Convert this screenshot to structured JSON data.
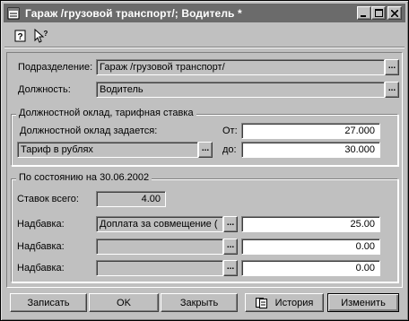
{
  "window": {
    "title": "Гараж /грузовой транспорт/; Водитель *"
  },
  "toolbar": {
    "help_icon": "help-icon",
    "whats_this_icon": "whats-this-icon"
  },
  "labels": {
    "department": "Подразделение:",
    "position": "Должность:",
    "salary_group": "Должностной оклад, тарифная ставка",
    "salary_set_by": "Должностной оклад задается:",
    "from": "От:",
    "to": "до:",
    "as_of_group": "По состоянию на 30.06.2002",
    "total_rates": "Ставок всего:",
    "bonus1": "Надбавка:",
    "bonus2": "Надбавка:",
    "bonus3": "Надбавка:"
  },
  "fields": {
    "department": "Гараж /грузовой транспорт/",
    "position": "Водитель",
    "salary_type": "Тариф в рублях",
    "from_value": "27.000",
    "to_value": "30.000",
    "total_rates": "4.00",
    "bonus1_type": "Доплата за совмещение (",
    "bonus1_value": "25.00",
    "bonus2_type": "",
    "bonus2_value": "0.00",
    "bonus3_type": "",
    "bonus3_value": "0.00"
  },
  "buttons": {
    "write": "Записать",
    "ok": "OK",
    "close": "Закрыть",
    "history": "История",
    "change": "Изменить",
    "ellipsis": "..."
  }
}
